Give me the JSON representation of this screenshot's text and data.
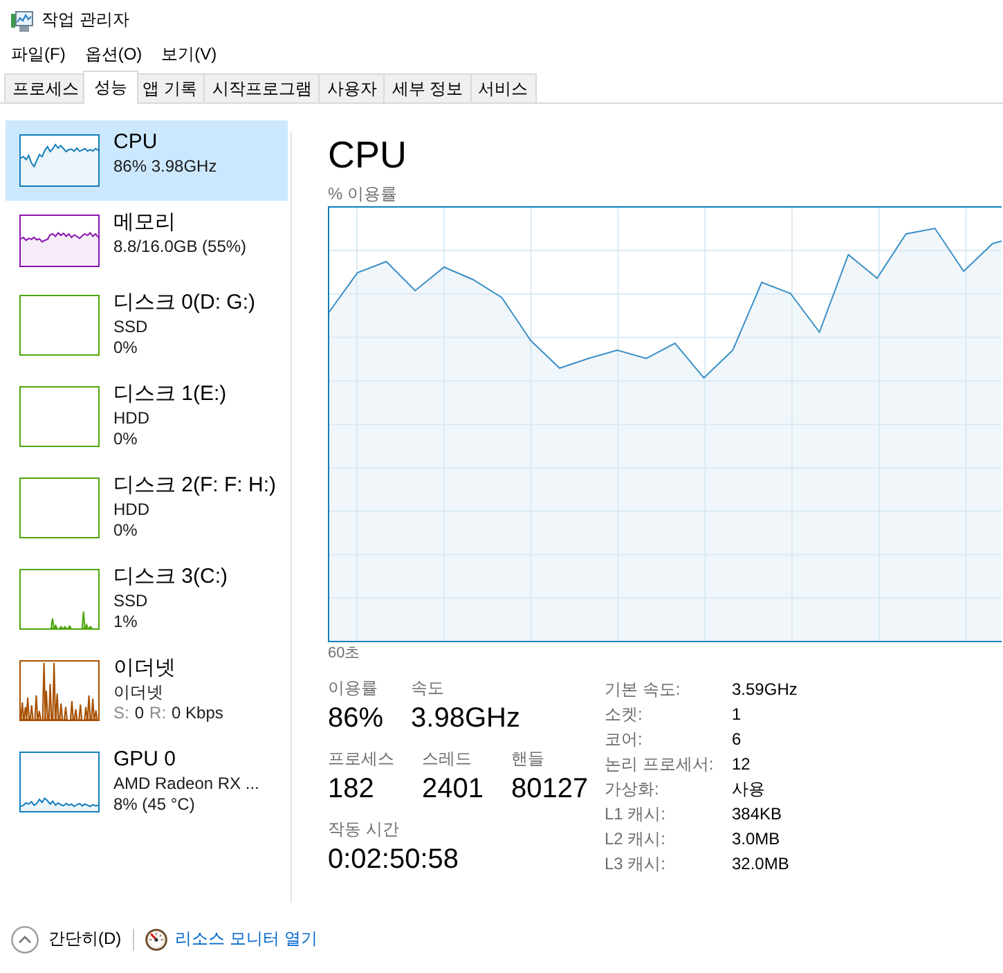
{
  "window": {
    "title": "작업 관리자"
  },
  "menu": [
    "파일(F)",
    "옵션(O)",
    "보기(V)"
  ],
  "tabs": [
    {
      "label": "프로세스",
      "selected": false
    },
    {
      "label": "성능",
      "selected": true
    },
    {
      "label": "앱 기록",
      "selected": false
    },
    {
      "label": "시작프로그램",
      "selected": false
    },
    {
      "label": "사용자",
      "selected": false
    },
    {
      "label": "세부 정보",
      "selected": false
    },
    {
      "label": "서비스",
      "selected": false
    }
  ],
  "sidebar": {
    "items": [
      {
        "title": "CPU",
        "color": "#117dbb",
        "selected": true,
        "details": [
          "86% 3.98GHz"
        ]
      },
      {
        "title": "메모리",
        "color": "#8b12ae",
        "selected": false,
        "details": [
          "8.8/16.0GB (55%)"
        ]
      },
      {
        "title": "디스크 0(D: G:)",
        "color": "#4da60c",
        "selected": false,
        "details": [
          "SSD",
          "0%"
        ]
      },
      {
        "title": "디스크 1(E:)",
        "color": "#4da60c",
        "selected": false,
        "details": [
          "HDD",
          "0%"
        ]
      },
      {
        "title": "디스크 2(F: F: H:)",
        "color": "#4da60c",
        "selected": false,
        "details": [
          "HDD",
          "0%"
        ]
      },
      {
        "title": "디스크 3(C:)",
        "color": "#4da60c",
        "selected": false,
        "details": [
          "SSD",
          "1%"
        ]
      },
      {
        "title": "이더넷",
        "color": "#a74f01",
        "selected": false,
        "details": [
          "이더넷"
        ],
        "traffic": [
          {
            "label": "S:",
            "value": "0"
          },
          {
            "label": "R:",
            "value": "0 Kbps"
          }
        ]
      },
      {
        "title": "GPU 0",
        "color": "#117dbb",
        "selected": false,
        "details": [
          "AMD Radeon RX ...",
          "8% (45 °C)"
        ]
      }
    ]
  },
  "panel": {
    "title": "CPU",
    "graph": {
      "caption": "% 이용률",
      "time_span": "60초"
    },
    "stat_rows": [
      {
        "stats": [
          {
            "label": "이용률",
            "value": "86%"
          },
          {
            "label": "속도",
            "value": "3.98GHz"
          }
        ]
      },
      {
        "stats": [
          {
            "label": "프로세스",
            "value": "182"
          },
          {
            "label": "스레드",
            "value": "2401"
          },
          {
            "label": "핸들",
            "value": "80127"
          }
        ]
      },
      {
        "stats": [
          {
            "label": "작동 시간",
            "value": "0:02:50:58"
          }
        ]
      }
    ],
    "specs": [
      {
        "label": "기본 속도:",
        "value": "3.59GHz"
      },
      {
        "label": "소켓:",
        "value": "1"
      },
      {
        "label": "코어:",
        "value": "6"
      },
      {
        "label": "논리 프로세서:",
        "value": "12"
      },
      {
        "label": "가상화:",
        "value": "사용"
      },
      {
        "label": "L1 캐시:",
        "value": "384KB"
      },
      {
        "label": "L2 캐시:",
        "value": "3.0MB"
      },
      {
        "label": "L3 캐시:",
        "value": "32.0MB"
      }
    ]
  },
  "footer": {
    "collapse_label": "간단히(D)",
    "link": "리소스 모니터 열기"
  }
}
